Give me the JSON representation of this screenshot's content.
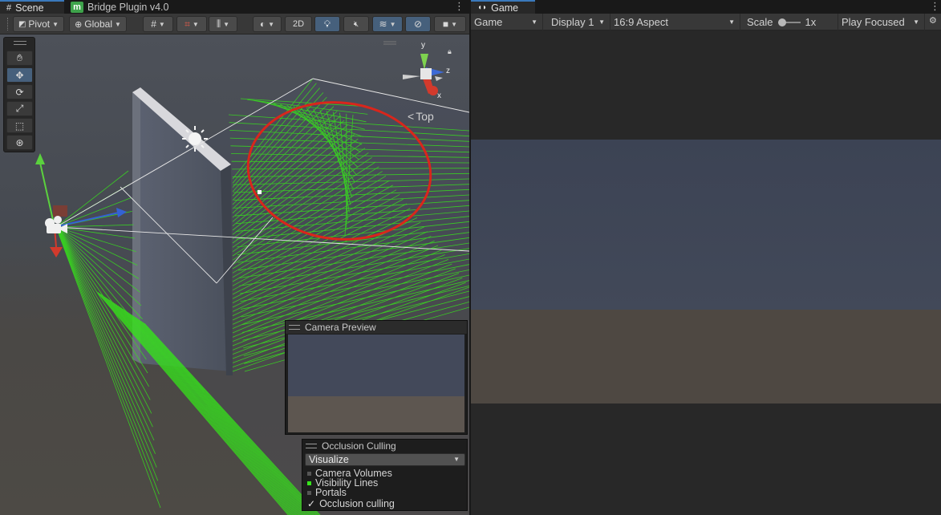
{
  "scene_tab": {
    "label": "Scene",
    "icon": "grid-icon"
  },
  "plugin_tab": {
    "label": "Bridge Plugin v4.0",
    "icon": "m-logo-icon",
    "brand_color": "#3ea34b"
  },
  "game_tab": {
    "label": "Game",
    "icon": "gamepad-icon"
  },
  "scene_toolbar": {
    "pivot": "Pivot",
    "global": "Global",
    "mode_2d": "2D"
  },
  "tools": [
    "hand",
    "move",
    "rotate",
    "scale",
    "rect",
    "transform"
  ],
  "gizmo": {
    "y": "y",
    "z": "z",
    "x": "x",
    "view": "Top"
  },
  "camera_preview": {
    "title": "Camera Preview"
  },
  "occlusion": {
    "title": "Occlusion Culling",
    "mode": "Visualize",
    "items": [
      "Camera Volumes",
      "Visibility Lines",
      "Portals"
    ],
    "checkbox_label": "Occlusion culling",
    "checked": true
  },
  "game_toolbar": {
    "mode": "Game",
    "display": "Display 1",
    "aspect": "16:9 Aspect",
    "scale_label": "Scale",
    "scale_value": "1x",
    "play_mode": "Play Focused"
  },
  "colors": {
    "accent": "#3a79bb",
    "active_tool": "#46607c",
    "visibility_lines": "#37e31c",
    "highlight_circle": "#d9261c"
  }
}
